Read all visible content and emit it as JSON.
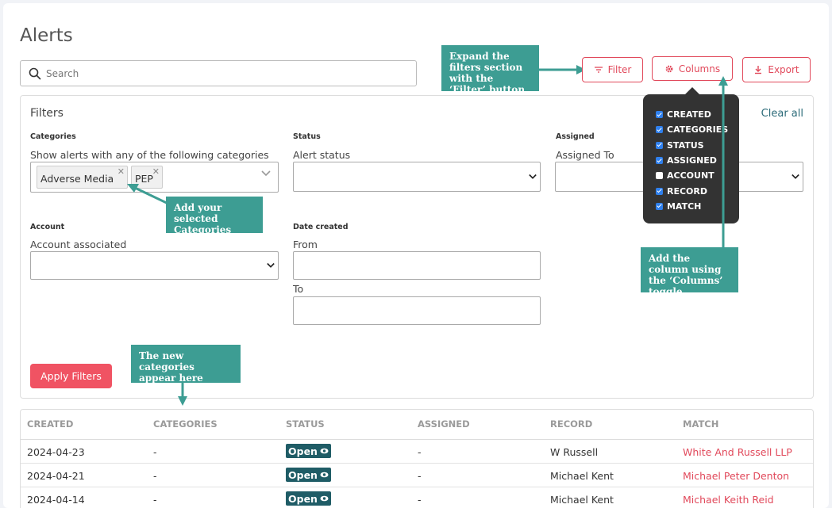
{
  "page_title": "Alerts",
  "search": {
    "placeholder": "Search"
  },
  "toolbar": {
    "filter_label": "Filter",
    "columns_label": "Columns",
    "export_label": "Export"
  },
  "callouts": {
    "filter": "Expand the filters section with the ‘Filter’ button",
    "categories": "Add your selected Categories here",
    "columns": "Add the column using the ‘Columns’ toggle",
    "new_categories": "The new categories appear here"
  },
  "filters": {
    "title": "Filters",
    "clear_all": "Clear all",
    "categories": {
      "label": "Categories",
      "sublabel": "Show alerts with any of the following categories",
      "chips": [
        "Adverse Media",
        "PEP"
      ]
    },
    "status": {
      "label": "Status",
      "sublabel": "Alert status",
      "value": ""
    },
    "assigned": {
      "label": "Assigned",
      "sublabel": "Assigned To",
      "value": ""
    },
    "account": {
      "label": "Account",
      "sublabel": "Account associated",
      "value": ""
    },
    "date_created": {
      "label": "Date created",
      "from_label": "From",
      "to_label": "To",
      "from_value": "",
      "to_value": ""
    },
    "apply_label": "Apply Filters"
  },
  "columns_menu": {
    "items": [
      {
        "label": "CREATED",
        "checked": true
      },
      {
        "label": "CATEGORIES",
        "checked": true
      },
      {
        "label": "STATUS",
        "checked": true
      },
      {
        "label": "ASSIGNED",
        "checked": true
      },
      {
        "label": "ACCOUNT",
        "checked": false
      },
      {
        "label": "RECORD",
        "checked": true
      },
      {
        "label": "MATCH",
        "checked": true
      }
    ]
  },
  "table": {
    "headers": [
      "CREATED",
      "CATEGORIES",
      "STATUS",
      "ASSIGNED",
      "RECORD",
      "MATCH"
    ],
    "rows": [
      {
        "created": "2024-04-23",
        "categories": "-",
        "status": "Open",
        "assigned": "-",
        "record": "W Russell",
        "match": "White And Russell LLP"
      },
      {
        "created": "2024-04-21",
        "categories": "-",
        "status": "Open",
        "assigned": "-",
        "record": "Michael Kent",
        "match": "Michael Peter Denton"
      },
      {
        "created": "2024-04-14",
        "categories": "-",
        "status": "Open",
        "assigned": "-",
        "record": "Michael Kent",
        "match": "Michael Keith Reid"
      }
    ]
  },
  "colors": {
    "accent": "#e1495b",
    "callout": "#3d9d93",
    "badge": "#1f5c66",
    "link": "#2c6b79"
  }
}
